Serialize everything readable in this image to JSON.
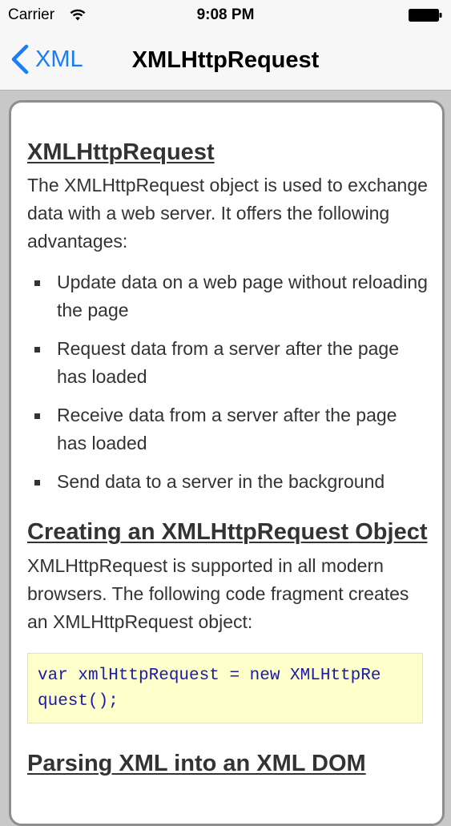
{
  "status_bar": {
    "carrier": "Carrier",
    "time": "9:08 PM",
    "wifi_icon": "wifi-icon",
    "battery_icon": "battery-icon"
  },
  "nav": {
    "back_label": "XML",
    "back_icon": "chevron-left-icon",
    "title": "XMLHttpRequest",
    "accent_color": "#1a7cf9"
  },
  "content": {
    "heading": "XMLHttpRequest",
    "intro": "The XMLHttpRequest object is used to exchange data with a web server. It offers the following advantages:",
    "advantages": [
      "Update data on a web page without reloading the page",
      "Request data from a server after the page has loaded",
      "Receive data from a server after the page has loaded",
      "Send data to a server in the background"
    ],
    "creating_heading": "Creating an XMLHttpRequest Object",
    "creating_text": "XMLHttpRequest is supported in all modern browsers. The following code fragment creates an XMLHttpRequest object:",
    "code_line_1": "var xmlHttpRequest = new XMLHttpRe",
    "code_line_2": "quest();",
    "parsing_heading": "Parsing XML into an XML DOM",
    "code_background": "#ffffcc",
    "code_color": "#1a1aa6"
  }
}
